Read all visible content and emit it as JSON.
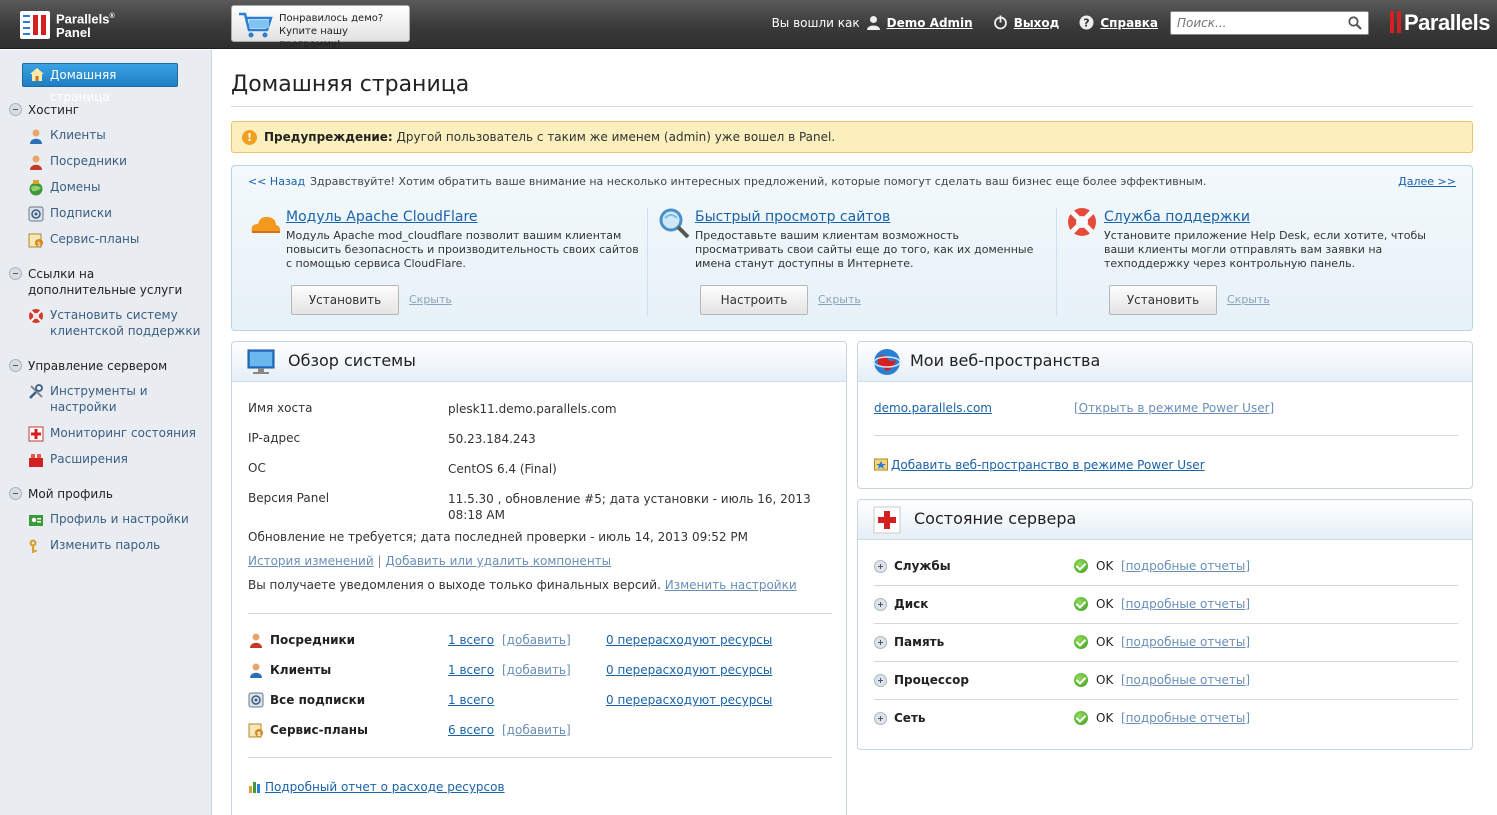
{
  "topbar": {
    "logo_line1": "Parallels",
    "logo_line2": "Panel",
    "promo_line1": "Понравилось демо?",
    "promo_line2": "Купите нашу программу!",
    "logged_in_as": "Вы вошли как",
    "user_name": "Demo Admin",
    "logout": "Выход",
    "help": "Справка",
    "search_placeholder": "Поиск...",
    "brand": "Parallels"
  },
  "sidebar": {
    "home": "Домашняя страница",
    "sections": [
      {
        "title": "Хостинг",
        "items": [
          "Клиенты",
          "Посредники",
          "Домены",
          "Подписки",
          "Сервис-планы"
        ]
      },
      {
        "title": "Ссылки на дополнительные услуги",
        "items": [
          "Установить систему клиентской поддержки"
        ]
      },
      {
        "title": "Управление сервером",
        "items": [
          "Инструменты и настройки",
          "Мониторинг состояния",
          "Расширения"
        ]
      },
      {
        "title": "Мой профиль",
        "items": [
          "Профиль и настройки",
          "Изменить пароль"
        ]
      }
    ]
  },
  "page": {
    "title": "Домашняя страница",
    "warning_label": "Предупреждение:",
    "warning_text": "Другой пользователь с таким же именем (admin) уже вошел в Panel."
  },
  "promo": {
    "back": "<< Назад",
    "intro": "Здравствуйте! Хотим обратить ваше внимание на несколько интересных предложений, которые помогут сделать ваш бизнес еще более эффективным.",
    "next": "Далее >>",
    "hide": "Скрыть",
    "items": [
      {
        "title": "Модуль Apache CloudFlare",
        "desc": "Модуль Apache mod_cloudflare позволит вашим клиентам повысить безопасность и производительность своих сайтов с помощью сервиса CloudFlare.",
        "button": "Установить"
      },
      {
        "title": "Быстрый просмотр сайтов",
        "desc": "Предоставьте вашим клиентам возможность просматривать свои сайты еще до того, как их доменные имена станут доступны в Интернете.",
        "button": "Настроить"
      },
      {
        "title": "Служба поддержки",
        "desc": "Установите приложение Help Desk, если хотите, чтобы ваши клиенты могли отправлять вам заявки на техподдержку через контрольную панель.",
        "button": "Установить"
      }
    ]
  },
  "overview": {
    "title": "Обзор системы",
    "host_label": "Имя хоста",
    "host": "plesk11.demo.parallels.com",
    "ip_label": "IP-адрес",
    "ip": "50.23.184.243",
    "os_label": "ОС",
    "os": "CentOS 6.4 (Final)",
    "version_label": "Версия Panel",
    "version_line1": "11.5.30 , обновление #5; дата установки - июль 16, 2013",
    "version_line2": "08:18 AM",
    "update_status": "Обновление не требуется; дата последней проверки - июль 14, 2013 09:52 PM",
    "changelog": "История изменений",
    "separator": "|",
    "components": "Добавить или удалить компоненты",
    "notify_text": "Вы получаете уведомления о выходе только финальных версий.",
    "change_settings": "Изменить настройки",
    "stats": [
      {
        "label": "Посредники",
        "total": "1 всего",
        "add": "[добавить]",
        "over": "0 перерасходуют ресурсы"
      },
      {
        "label": "Клиенты",
        "total": "1 всего",
        "add": "[добавить]",
        "over": "0 перерасходуют ресурсы"
      },
      {
        "label": "Все подписки",
        "total": "1 всего",
        "add": "",
        "over": "0 перерасходуют ресурсы"
      },
      {
        "label": "Сервис-планы",
        "total": "6 всего",
        "add": "[добавить]",
        "over": ""
      }
    ],
    "resource_report": "Подробный отчет о расходе ресурсов"
  },
  "webspaces": {
    "title": "Мои веб-пространства",
    "domain": "demo.parallels.com",
    "power_user": "[Открыть в режиме Power User]",
    "add": "Добавить веб-пространство в режиме Power User"
  },
  "server_status": {
    "title": "Состояние сервера",
    "ok": "OK",
    "details": "[подробные отчеты]",
    "rows": [
      "Службы",
      "Диск",
      "Память",
      "Процессор",
      "Сеть"
    ]
  },
  "colors": {
    "accent": "#1a63a9",
    "topbar": "#3a3a3a",
    "home_button": "#2a8fd4",
    "warning_bg": "#fbf0bd",
    "ok_green": "#3f9a1d"
  }
}
